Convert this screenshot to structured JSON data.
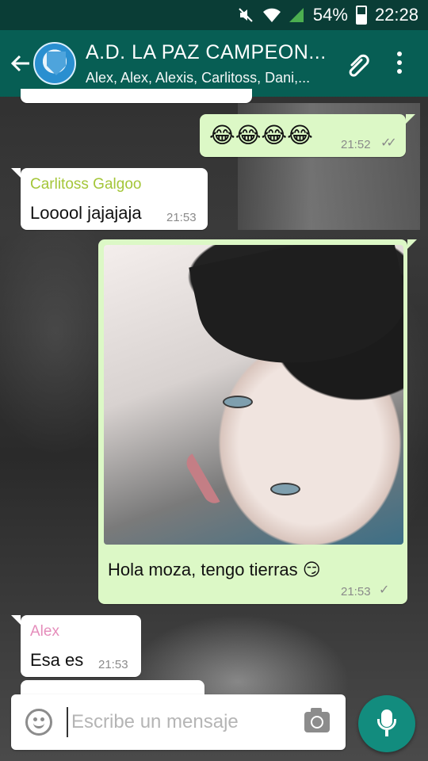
{
  "status_bar": {
    "battery": "54%",
    "time": "22:28"
  },
  "chat": {
    "title": "A.D. LA PAZ CAMPEON...",
    "members": "Alex, Alex, Alexis, Carlitoss, Dani,..."
  },
  "messages": [
    {
      "direction": "out",
      "text": "😂😂😂😂",
      "time": "21:52",
      "status": "read"
    },
    {
      "direction": "in",
      "sender": "Carlitoss Galgoo",
      "sender_color": "#a4c639",
      "text": "Looool jajajaja",
      "time": "21:53"
    },
    {
      "direction": "out",
      "type": "image",
      "caption": "Hola moza, tengo tierras 😏",
      "time": "21:53",
      "status": "sent"
    },
    {
      "direction": "in",
      "sender": "Alex",
      "sender_color": "#e58dbb",
      "text": "Esa es",
      "time": "21:53"
    }
  ],
  "composer": {
    "placeholder": "Escribe un mensaje"
  },
  "colors": {
    "header": "#075e54",
    "status_bar": "#0a3d36",
    "outgoing": "#dcf8c6",
    "fab": "#128c7e"
  }
}
